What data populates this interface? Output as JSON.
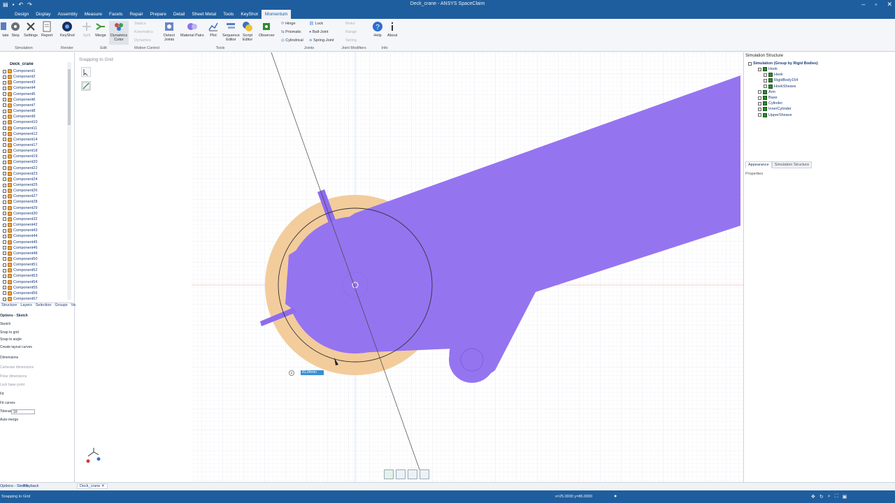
{
  "app": {
    "title": "Deck_crane - ANSYS SpaceClaim"
  },
  "menu": [
    "Design",
    "Display",
    "Assembly",
    "Measure",
    "Facets",
    "Repair",
    "Prepare",
    "Detail",
    "Sheet Metal",
    "Tools",
    "KeyShot",
    "Momentum"
  ],
  "menu_active": "Momentum",
  "ribbon": {
    "simulation": {
      "state": "tate",
      "step": "Step",
      "settings": "Settings",
      "report": "Report",
      "group": "Simulation"
    },
    "render": {
      "keyshot": "KeyShot",
      "group": "Render"
    },
    "edit": {
      "split": "Split",
      "merge": "Merge",
      "group": "Edit"
    },
    "motion": {
      "dynamics": "Dynamics",
      "color": "Color",
      "statics": "Statics",
      "kinematics": "Kinematics",
      "dynamics2": "Dynamics",
      "group": "Motion Control"
    },
    "tools": {
      "detect": "Detect",
      "joints": "Joints",
      "material": "Material Pairs",
      "plot": "Plot",
      "sequence": "Sequence",
      "editor": "Editor",
      "script": "Script",
      "editor2": "Editor",
      "observer": "Observer",
      "group": "Tools"
    },
    "joints": {
      "hinge": "Hinge",
      "lock": "Lock",
      "prismatic": "Prismatic",
      "ball": "Ball-Joint",
      "cylindrical": "Cylindrical",
      "spring": "Spring-Joint",
      "group": "Joints"
    },
    "joint_modifiers": {
      "motor": "Motor",
      "range": "Range",
      "spring": "Spring",
      "group": "Joint Modifiers"
    },
    "info": {
      "help": "Help",
      "about": "About",
      "group": "Info"
    }
  },
  "tree": {
    "root": "Deck_crane",
    "items": [
      "Component1",
      "Component2",
      "Component3",
      "Component4",
      "Component5",
      "Component6",
      "Component7",
      "Component8",
      "Component9",
      "Component10",
      "Component11",
      "Component12",
      "Component14",
      "Component17",
      "Component18",
      "Component19",
      "Component20",
      "Component22",
      "Component23",
      "Component24",
      "Component25",
      "Component26",
      "Component27",
      "Component28",
      "Component29",
      "Component30",
      "Component32",
      "Component42",
      "Component43",
      "Component44",
      "Component45",
      "Component46",
      "Component48",
      "Component50",
      "Component51",
      "Component52",
      "Component53",
      "Component54",
      "Component55",
      "Component56",
      "Component57"
    ]
  },
  "panel_tabs": [
    "Structure",
    "Layers",
    "Selection",
    "Groups",
    "Views"
  ],
  "options": {
    "header": "Options - Sketch",
    "items": [
      "Sketch",
      "Snap to grid",
      "Snap to angle",
      "Create layout curves",
      "Dimensions",
      "Cartesian dimensions",
      "Polar dimensions",
      "Lock base point",
      "Fit",
      "Fit curves",
      "Tolerance",
      "Auto-merge"
    ],
    "tolerance_value": "10"
  },
  "canvas": {
    "snap_label": "Snapping to Grid",
    "dimension_value": "81.04mm",
    "doc_tab": "Deck_crane"
  },
  "structure": {
    "header": "Simulation Structure",
    "root": "Simulation (Group by Rigid Bodies)",
    "items": [
      "Hook",
      "Hook",
      "RigidBody154",
      "HookSheave",
      "Arm",
      "Base",
      "Cylinder",
      "InnerCylinder",
      "UpperSheave"
    ],
    "tab_appearance": "Appearance",
    "tab_structure": "Simulation Structure",
    "properties": "Properties"
  },
  "bottom": {
    "tab_options": "Options - Sketch",
    "tab_playback": "Playback"
  },
  "status": {
    "left": "Snapping to Grid",
    "coords": "x=25.0000  y=86.0000"
  },
  "colors": {
    "brand": "#1f5e9e",
    "arm": "#9574f0",
    "sheave": "#f3cc9c"
  }
}
